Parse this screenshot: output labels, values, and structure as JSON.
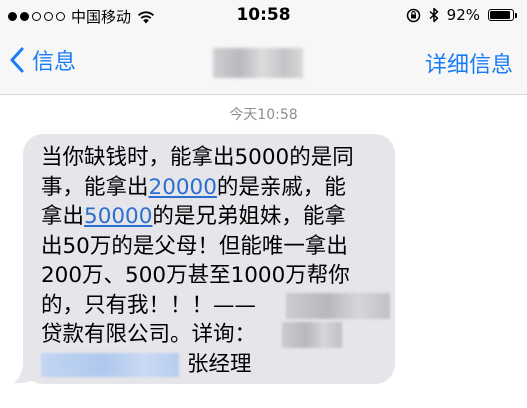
{
  "status_bar": {
    "carrier": "中国移动",
    "time": "10:58",
    "battery_percent": "92%",
    "battery_level": 0.92,
    "signal_bars_filled": 2,
    "signal_bars_total": 5
  },
  "nav": {
    "back_label": "信息",
    "details_label": "详细信息"
  },
  "timestamp": "今天10:58",
  "message": {
    "line1": "当你缺钱时，能拿出5000的是同",
    "line2_a": "事，能拿出",
    "line2_link": "20000",
    "line2_b": "的是亲戚，能",
    "line3_a": "拿出",
    "line3_link": "50000",
    "line3_b": "的是兄弟姐妹，能拿",
    "line4": "出50万的是父母！但能唯一拿出",
    "line5": "200万、500万甚至1000万帮你",
    "line6": "的，只有我！！！——",
    "line7": "贷款有限公司。详询：",
    "line8": "张经理"
  },
  "colors": {
    "accent": "#1a7cf5",
    "bubble": "#e5e5ea",
    "link": "#2a6fd0",
    "timestamp": "#8e8e93"
  }
}
